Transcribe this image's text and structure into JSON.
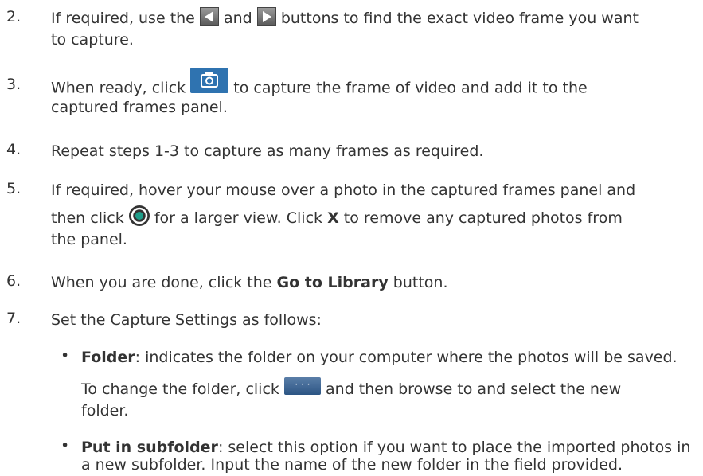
{
  "steps": [
    {
      "num": "2.",
      "l1a": "If required, use the",
      "l1b": "and",
      "l1c": "buttons to find the exact video frame you want",
      "l2": "to capture."
    },
    {
      "num": "3.",
      "l1a": "When ready, click",
      "l1b": "to capture the frame of video and add it to the",
      "l2": "captured frames panel."
    },
    {
      "num": "4.",
      "l1": "Repeat steps 1-3 to capture as many frames as required."
    },
    {
      "num": "5.",
      "l1": "If required, hover your mouse over a photo in the captured frames panel and",
      "l2a": "then click",
      "l2b": "for a larger view. Click",
      "l2bold": "X",
      "l2c": "to remove any captured photos from",
      "l3": "the panel."
    },
    {
      "num": "6.",
      "l1a": "When you are done, click the",
      "l1bold": "Go to Library",
      "l1b": "button."
    },
    {
      "num": "7.",
      "l1": "Set the Capture Settings as follows:"
    }
  ],
  "bullets": [
    {
      "bold": "Folder",
      "l1": ": indicates the folder on your computer where the photos will be saved.",
      "l2a": "To change the folder, click",
      "l2b": "and then browse to and select the new",
      "l3": "folder."
    },
    {
      "bold": "Put in subfolder",
      "l1": ": select this option if you want to place the imported photos in",
      "l2": "a new subfolder. Input the name of the new folder in the field provided."
    }
  ],
  "icons": {
    "prev": "previous-frame-icon",
    "next": "next-frame-icon",
    "capture": "camera-icon",
    "view": "view-icon",
    "browse": "ellipsis-icon"
  },
  "browse_label": "· · ·"
}
